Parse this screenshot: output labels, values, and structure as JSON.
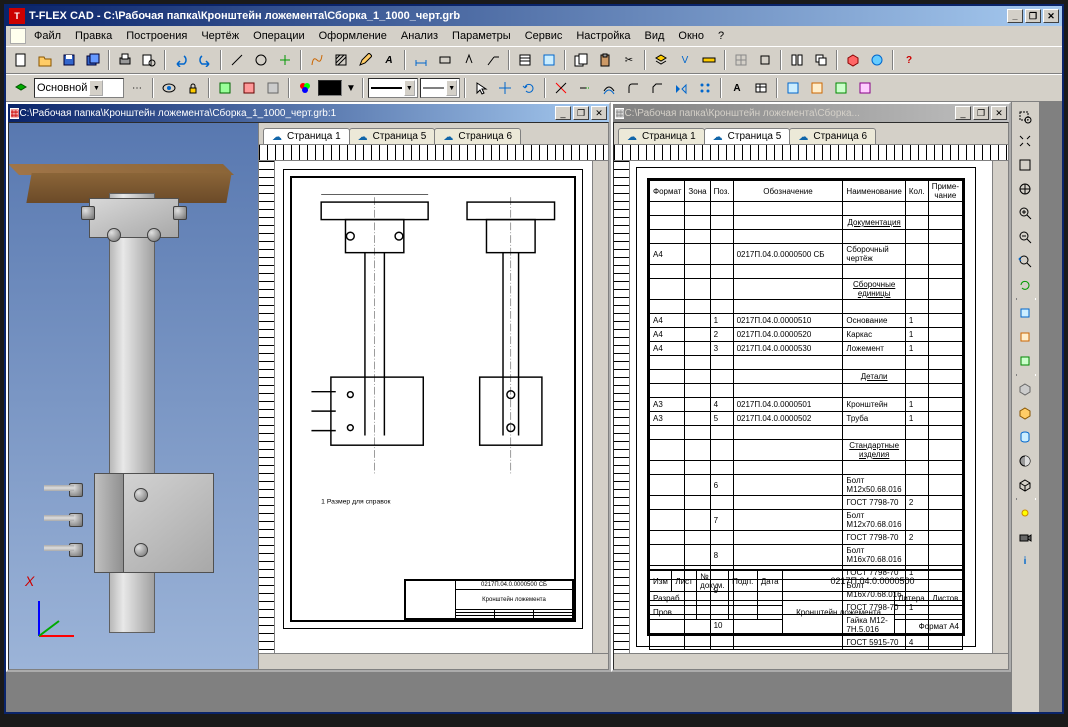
{
  "app": {
    "title": "T-FLEX CAD - С:\\Рабочая папка\\Кронштейн ложемента\\Сборка_1_1000_черт.grb"
  },
  "menu": [
    "Файл",
    "Правка",
    "Построения",
    "Чертёж",
    "Операции",
    "Оформление",
    "Анализ",
    "Параметры",
    "Сервис",
    "Настройка",
    "Вид",
    "Окно",
    "?"
  ],
  "secondary_toolbar": {
    "layer_combo": "Основной"
  },
  "doc_left": {
    "title": "С:\\Рабочая папка\\Кронштейн ложемента\\Сборка_1_1000_черт.grb:1",
    "tabs": [
      "Страница 1",
      "Страница 5",
      "Страница 6"
    ]
  },
  "doc_right": {
    "title": "С:\\Рабочая папка\\Кронштейн ложемента\\Сборка...",
    "tabs": [
      "Страница 1",
      "Страница 5",
      "Страница 6"
    ]
  },
  "axis": {
    "x": "X"
  },
  "drawing": {
    "note1": "1 Размер для справок",
    "titleblock_name": "Кронштейн ложемента",
    "titleblock_num": "0217П.04.0.0000500 СБ"
  },
  "bom": {
    "headers": {
      "format": "Формат",
      "zone": "Зона",
      "pos": "Поз.",
      "designation": "Обозначение",
      "name": "Наименование",
      "qty": "Кол.",
      "note": "Приме-чание"
    },
    "sections": {
      "docs": "Документация",
      "assemblies": "Сборочные единицы",
      "parts": "Детали",
      "standard": "Стандартные изделия"
    },
    "rows": [
      {
        "pos": "",
        "des": "0217П.04.0.0000500 СБ",
        "name": "Сборочный чертёж",
        "qty": ""
      },
      {
        "pos": "1",
        "des": "0217П.04.0.0000510",
        "name": "Основание",
        "qty": "1"
      },
      {
        "pos": "2",
        "des": "0217П.04.0.0000520",
        "name": "Каркас",
        "qty": "1"
      },
      {
        "pos": "3",
        "des": "0217П.04.0.0000530",
        "name": "Ложемент",
        "qty": "1"
      },
      {
        "pos": "4",
        "des": "0217П.04.0.0000501",
        "name": "Кронштейн",
        "qty": "1"
      },
      {
        "pos": "5",
        "des": "0217П.04.0.0000502",
        "name": "Труба",
        "qty": "1"
      },
      {
        "pos": "6",
        "des": "",
        "name": "Болт М12х50.68.016",
        "qty": ""
      },
      {
        "pos": "",
        "des": "",
        "name": "ГОСТ 7798-70",
        "qty": "2"
      },
      {
        "pos": "7",
        "des": "",
        "name": "Болт М12х70.68.016",
        "qty": ""
      },
      {
        "pos": "",
        "des": "",
        "name": "ГОСТ 7798-70",
        "qty": "2"
      },
      {
        "pos": "8",
        "des": "",
        "name": "Болт М16х70.68.016",
        "qty": ""
      },
      {
        "pos": "",
        "des": "",
        "name": "ГОСТ 7798-70",
        "qty": "1"
      },
      {
        "pos": "9",
        "des": "",
        "name": "Болт М16х70.68.016",
        "qty": ""
      },
      {
        "pos": "",
        "des": "",
        "name": "ГОСТ 7798-70",
        "qty": "1"
      },
      {
        "pos": "10",
        "des": "",
        "name": "Гайка М12-7Н.5.016",
        "qty": ""
      },
      {
        "pos": "",
        "des": "",
        "name": "ГОСТ 5915-70",
        "qty": "4"
      }
    ],
    "footer_num": "0217П.04.0.0000500",
    "footer_name": "Кронштейн ложемента",
    "footer_labels": {
      "izm": "Изм",
      "list": "Лист",
      "ndoc": "№ докум.",
      "podp": "Подп.",
      "data": "Дата",
      "razrab": "Разраб.",
      "prov": "Пров.",
      "litera": "Литера",
      "listov": "Листов",
      "format": "Формат А4"
    }
  }
}
